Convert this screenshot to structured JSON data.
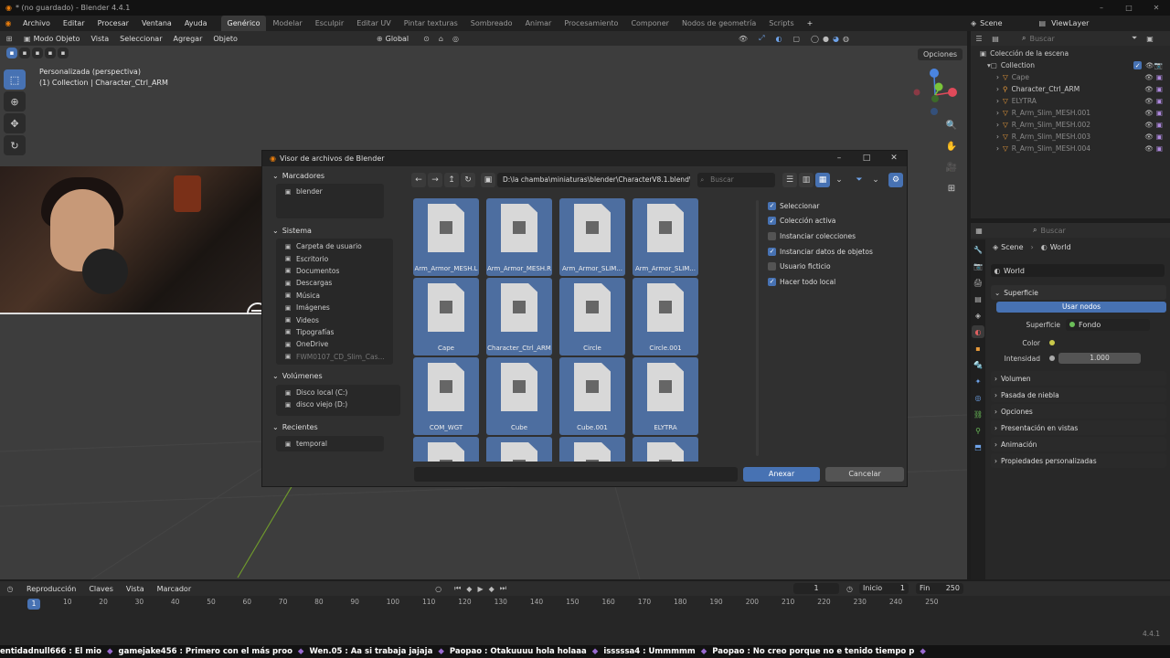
{
  "window": {
    "title": "* (no guardado) - Blender 4.4.1"
  },
  "menu": {
    "items": [
      "Archivo",
      "Editar",
      "Procesar",
      "Ventana",
      "Ayuda"
    ],
    "workspaces": [
      "Genérico",
      "Modelar",
      "Esculpir",
      "Editar UV",
      "Pintar texturas",
      "Sombreado",
      "Animar",
      "Procesamiento",
      "Componer",
      "Nodos de geometría",
      "Scripts"
    ],
    "active_workspace": "Genérico",
    "scene": "Scene",
    "view_layer": "ViewLayer"
  },
  "viewport": {
    "mode": "Modo Objeto",
    "menus": [
      "Vista",
      "Seleccionar",
      "Agregar",
      "Objeto"
    ],
    "orientation": "Global",
    "info_line1": "Personalizada (perspectiva)",
    "info_line2": "(1) Collection | Character_Ctrl_ARM",
    "options": "Opciones"
  },
  "outliner": {
    "search": "Buscar",
    "root": "Colección de la escena",
    "collection": "Collection",
    "objects": [
      "Cape",
      "Character_Ctrl_ARM",
      "ELYTRA",
      "R_Arm_Slim_MESH.001",
      "R_Arm_Slim_MESH.002",
      "R_Arm_Slim_MESH.003",
      "R_Arm_Slim_MESH.004"
    ]
  },
  "properties": {
    "search": "Buscar",
    "breadcrumb_scene": "Scene",
    "breadcrumb_world": "World",
    "world_name": "World",
    "surface_section": "Superficie",
    "use_nodes": "Usar nodos",
    "surface_label": "Superficie",
    "surface_value": "Fondo",
    "color_label": "Color",
    "strength_label": "Intensidad",
    "strength_value": "1.000",
    "sections": [
      "Volumen",
      "Pasada de niebla",
      "Opciones",
      "Presentación en vistas",
      "Animación",
      "Propiedades personalizadas"
    ]
  },
  "dialog": {
    "title": "Visor de archivos de Blender",
    "bookmarks_header": "Marcadores",
    "bookmarks": [
      "blender"
    ],
    "system_header": "Sistema",
    "system": [
      "Carpeta de usuario",
      "Escritorio",
      "Documentos",
      "Descargas",
      "Música",
      "Imágenes",
      "Videos",
      "Tipografías",
      "OneDrive",
      "FWM0107_CD_Slim_Cas..."
    ],
    "volumes_header": "Volúmenes",
    "volumes": [
      "Disco local (C:)",
      "disco viejo (D:)"
    ],
    "recent_header": "Recientes",
    "recent": [
      "temporal"
    ],
    "path": "D:\\la chamba\\miniaturas\\blender\\CharacterV8.1.blend\\...",
    "search": "Buscar",
    "files": [
      "Arm_Armor_MESH.L",
      "Arm_Armor_MESH.R",
      "Arm_Armor_SLIM...",
      "Arm_Armor_SLIM...",
      "Cape",
      "Character_Ctrl_ARM",
      "Circle",
      "Circle.001",
      "COM_WGT",
      "Cube",
      "Cube.001",
      "ELYTRA",
      "",
      "",
      "",
      ""
    ],
    "options": [
      {
        "label": "Seleccionar",
        "on": true
      },
      {
        "label": "Colección activa",
        "on": true
      },
      {
        "label": "Instanciar colecciones",
        "on": false
      },
      {
        "label": "Instanciar datos de objetos",
        "on": true
      },
      {
        "label": "Usuario ficticio",
        "on": false
      },
      {
        "label": "Hacer todo local",
        "on": true
      }
    ],
    "ok": "Anexar",
    "cancel": "Cancelar"
  },
  "timeline": {
    "menus": [
      "Reproducción",
      "Claves",
      "Vista",
      "Marcador"
    ],
    "current_frame": "1",
    "start_label": "Inicio",
    "start": "1",
    "end_label": "Fin",
    "end": "250",
    "ticks": [
      "10",
      "20",
      "30",
      "40",
      "50",
      "60",
      "70",
      "80",
      "90",
      "100",
      "110",
      "120",
      "130",
      "140",
      "150",
      "160",
      "170",
      "180",
      "190",
      "200",
      "210",
      "220",
      "230",
      "240",
      "250"
    ],
    "frame_marker": "1",
    "version": "4.4.1"
  },
  "chat": [
    "entidadnull666 : El mio",
    "gamejake456 : Primero con el más proo",
    "Wen.05 : Aa si trabaja jajaja",
    "Paopao : Otakuuuu hola holaaa",
    "isssssa4 : Ummmmm",
    "Paopao : No creo porque no e tenido tiempo p"
  ],
  "colors": {
    "accent": "#4772b3",
    "file_tile": "#4d6ea0",
    "bg": "#3d3d3d"
  }
}
